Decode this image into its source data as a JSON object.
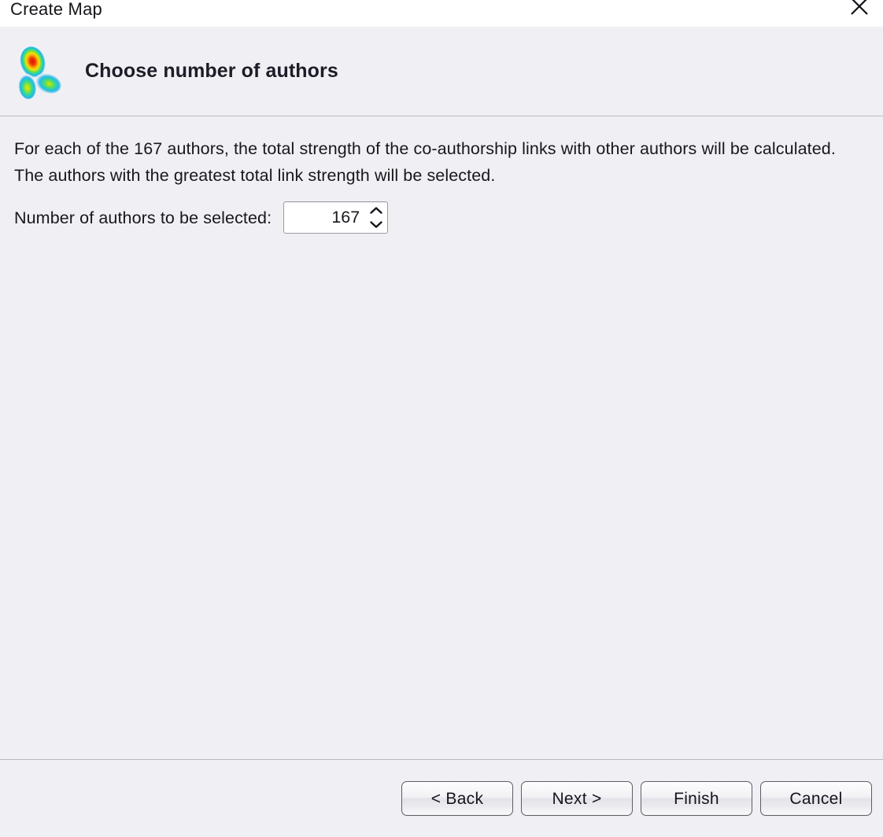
{
  "window": {
    "title": "Create Map",
    "close_icon": "close-icon"
  },
  "header": {
    "logo_icon": "vosviewer-density-map-logo-icon",
    "title": "Choose number of authors"
  },
  "main": {
    "description": "For each of the 167 authors, the total strength of the co-authorship links with other authors will be calculated. The authors with the greatest total link strength will be selected.",
    "field": {
      "label": "Number of authors to be selected:",
      "value": "167",
      "placeholder": "",
      "increment_icon": "chevron-up-icon",
      "decrement_icon": "chevron-down-icon"
    }
  },
  "footer": {
    "buttons": [
      {
        "label": "< Back"
      },
      {
        "label": "Next >"
      },
      {
        "label": "Finish"
      },
      {
        "label": "Cancel"
      }
    ]
  },
  "colors": {
    "background": "#f0f0f4",
    "titlebar": "#ffffff",
    "text": "#18181c",
    "separator": "#b9b9c2",
    "button_border": "#5d5d66"
  }
}
